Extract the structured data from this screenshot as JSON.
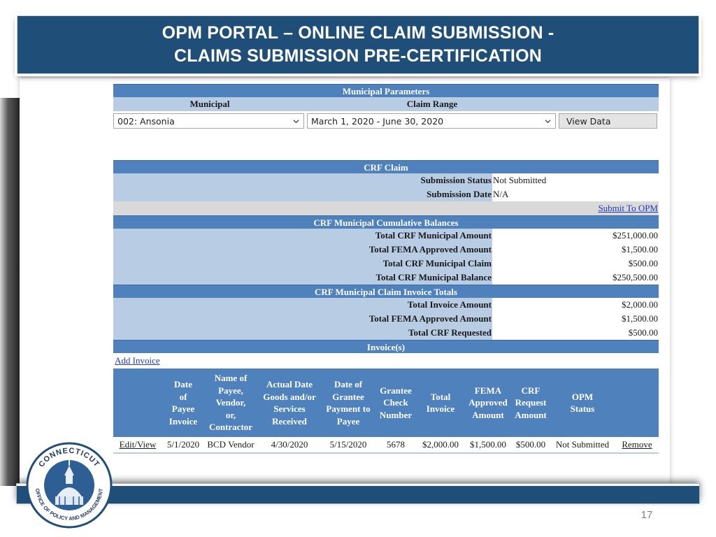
{
  "slide": {
    "title_line1": "OPM PORTAL – ONLINE CLAIM SUBMISSION -",
    "title_line2": "CLAIMS SUBMISSION PRE-CERTIFICATION",
    "page_number": "17",
    "seal_text_top": "CONNECTICUT",
    "seal_text_bottom": "OFFICE OF POLICY AND MANAGEMENT"
  },
  "parameters": {
    "header": "Municipal Parameters",
    "municipal_label": "Municipal",
    "claim_range_label": "Claim Range",
    "municipal_value": "002: Ansonia",
    "claim_range_value": "March 1, 2020 - June 30, 2020",
    "view_button": "View Data"
  },
  "claim": {
    "header": "CRF Claim",
    "submission_status_label": "Submission Status",
    "submission_status_value": "Not Submitted",
    "submission_date_label": "Submission Date",
    "submission_date_value": "N/A",
    "submit_link": "Submit To OPM"
  },
  "balances": {
    "header": "CRF Municipal Cumulative Balances",
    "rows": [
      {
        "label": "Total CRF Municipal Amount",
        "value": "$251,000.00"
      },
      {
        "label": "Total FEMA Approved Amount",
        "value": "$1,500.00"
      },
      {
        "label": "Total CRF Municipal Claim",
        "value": "$500.00"
      },
      {
        "label": "Total CRF Municipal Balance",
        "value": "$250,500.00"
      }
    ]
  },
  "invoice_totals": {
    "header": "CRF Municipal Claim Invoice Totals",
    "rows": [
      {
        "label": "Total Invoice Amount",
        "value": "$2,000.00"
      },
      {
        "label": "Total FEMA Approved Amount",
        "value": "$1,500.00"
      },
      {
        "label": "Total CRF Requested",
        "value": "$500.00"
      }
    ]
  },
  "invoices": {
    "header": "Invoice(s)",
    "add_link": "Add Invoice",
    "columns": [
      {
        "line1": "",
        "line2": "",
        "line3": "",
        "line4": "",
        "line5": ""
      },
      {
        "line1": "Date",
        "line2": "of",
        "line3": "Payee",
        "line4": "Invoice",
        "line5": ""
      },
      {
        "line1": "Name of",
        "line2": "Payee,",
        "line3": "Vendor,",
        "line4": "or,",
        "line5": "Contractor"
      },
      {
        "line1": "Actual Date",
        "line2": "Goods and/or",
        "line3": "Services",
        "line4": "Received",
        "line5": ""
      },
      {
        "line1": "Date of",
        "line2": "Grantee",
        "line3": "Payment to",
        "line4": "Payee",
        "line5": ""
      },
      {
        "line1": "Grantee",
        "line2": "Check",
        "line3": "Number",
        "line4": "",
        "line5": ""
      },
      {
        "line1": "Total",
        "line2": "Invoice",
        "line3": "",
        "line4": "",
        "line5": ""
      },
      {
        "line1": "FEMA",
        "line2": "Approved",
        "line3": "Amount",
        "line4": "",
        "line5": ""
      },
      {
        "line1": "CRF",
        "line2": "Request",
        "line3": "Amount",
        "line4": "",
        "line5": ""
      },
      {
        "line1": "OPM",
        "line2": "Status",
        "line3": "",
        "line4": "",
        "line5": ""
      },
      {
        "line1": "",
        "line2": "",
        "line3": "",
        "line4": "",
        "line5": ""
      }
    ],
    "rows": [
      {
        "edit": "Edit/View",
        "date_of_invoice": "5/1/2020",
        "payee": "BCD Vendor",
        "received_date": "4/30/2020",
        "payment_date": "5/15/2020",
        "check_number": "5678",
        "total_invoice": "$2,000.00",
        "fema_amount": "$1,500.00",
        "crf_amount": "$500.00",
        "opm_status": "Not Submitted",
        "remove": "Remove"
      }
    ]
  },
  "colors": {
    "header_blue": "#4f81bd",
    "label_blue": "#b8cce4",
    "slide_blue": "#1f4e79",
    "link_blue": "#1f3ac0"
  }
}
